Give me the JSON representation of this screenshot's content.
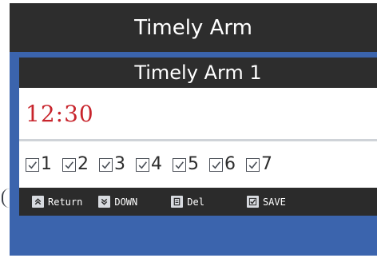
{
  "app": {
    "title": "Timely Arm"
  },
  "dialog": {
    "header": "Timely Arm 1",
    "time": "12:30",
    "days": [
      {
        "label": "1",
        "checked": false
      },
      {
        "label": "2",
        "checked": false
      },
      {
        "label": "3",
        "checked": false
      },
      {
        "label": "4",
        "checked": false
      },
      {
        "label": "5",
        "checked": false
      },
      {
        "label": "6",
        "checked": false
      },
      {
        "label": "7",
        "checked": false
      }
    ]
  },
  "buttons": {
    "return_label": "Return",
    "down_label": "DOWN",
    "del_label": "Del",
    "save_label": "SAVE"
  },
  "colors": {
    "background_blue": "#3b64ad",
    "bar_dark": "#2d2d2d",
    "time_red": "#c8242c"
  }
}
